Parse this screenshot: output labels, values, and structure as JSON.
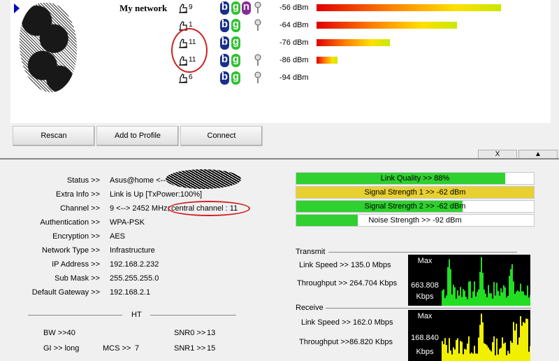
{
  "network_list": {
    "rows": [
      {
        "ssid": "My network",
        "channel": "9",
        "modes": [
          "b",
          "g",
          "n"
        ],
        "locked": true,
        "signal": "-56 dBm",
        "strength": 0.88
      },
      {
        "ssid": "",
        "channel": "1",
        "modes": [
          "b",
          "g"
        ],
        "locked": true,
        "signal": "-64 dBm",
        "strength": 0.67
      },
      {
        "ssid": "",
        "channel": "11",
        "modes": [
          "b",
          "g"
        ],
        "locked": false,
        "signal": "-76 dBm",
        "strength": 0.35
      },
      {
        "ssid": "",
        "channel": "11",
        "modes": [
          "b",
          "g"
        ],
        "locked": true,
        "signal": "-86 dBm",
        "strength": 0.1
      },
      {
        "ssid": "",
        "channel": "6",
        "modes": [
          "b",
          "g"
        ],
        "locked": true,
        "signal": "-94 dBm",
        "strength": 0.0
      }
    ]
  },
  "buttons": {
    "rescan": "Rescan",
    "add_profile": "Add to Profile",
    "connect": "Connect"
  },
  "tabs": {
    "close": "X",
    "collapse": "▲"
  },
  "status": {
    "status_label": "Status >>",
    "status_value": "Asus@home <--",
    "extra_label": "Extra Info >>",
    "extra_value": "Link is Up [TxPower:100%]",
    "channel_label": "Channel >>",
    "channel_value": "9 <--> 2452 MHz;",
    "central_channel": "central channel : 11",
    "auth_label": "Authentication >>",
    "auth_value": "WPA-PSK",
    "enc_label": "Encryption >>",
    "enc_value": "AES",
    "nettype_label": "Network Type >>",
    "nettype_value": "Infrastructure",
    "ip_label": "IP Address >>",
    "ip_value": "192.168.2.232",
    "mask_label": "Sub Mask >>",
    "mask_value": "255.255.255.0",
    "gw_label": "Default Gateway >>",
    "gw_value": "192.168.2.1"
  },
  "ht": {
    "title": "HT",
    "bw": "BW >>40",
    "gi": "GI >> long",
    "mcs_label": "MCS >>",
    "mcs_value": "7",
    "snr0_label": "SNR0 >>",
    "snr0_value": "13",
    "snr1_label": "SNR1 >>",
    "snr1_value": "15"
  },
  "meters": [
    {
      "text": "Link Quality >> 88%",
      "fill": 0.88,
      "color": "#2fd02f"
    },
    {
      "text": "Signal Strength 1 >> -62 dBm",
      "fill": 1.0,
      "color": "#e8d030"
    },
    {
      "text": "Signal Strength 2 >> -62 dBm",
      "fill": 0.7,
      "color": "#2fd02f"
    },
    {
      "text": "Noise Strength >> -92 dBm",
      "fill": 0.26,
      "color": "#2fd02f"
    }
  ],
  "transmit": {
    "title": "Transmit",
    "link_speed": "Link Speed >>  135.0 Mbps",
    "throughput": "Throughput >> 264.704 Kbps",
    "max": "Max",
    "graph_value": "663.808",
    "graph_unit": "Kbps"
  },
  "receive": {
    "title": "Receive",
    "link_speed": "Link Speed >>  162.0 Mbps",
    "throughput": "Throughput >>86.820 Kbps",
    "max": "Max",
    "graph_value": "168.840",
    "graph_unit": "Kbps"
  },
  "colors": {
    "tx_graph": "#22dd22",
    "rx_graph": "#f0f000",
    "highlight_ring": "#d02020"
  }
}
